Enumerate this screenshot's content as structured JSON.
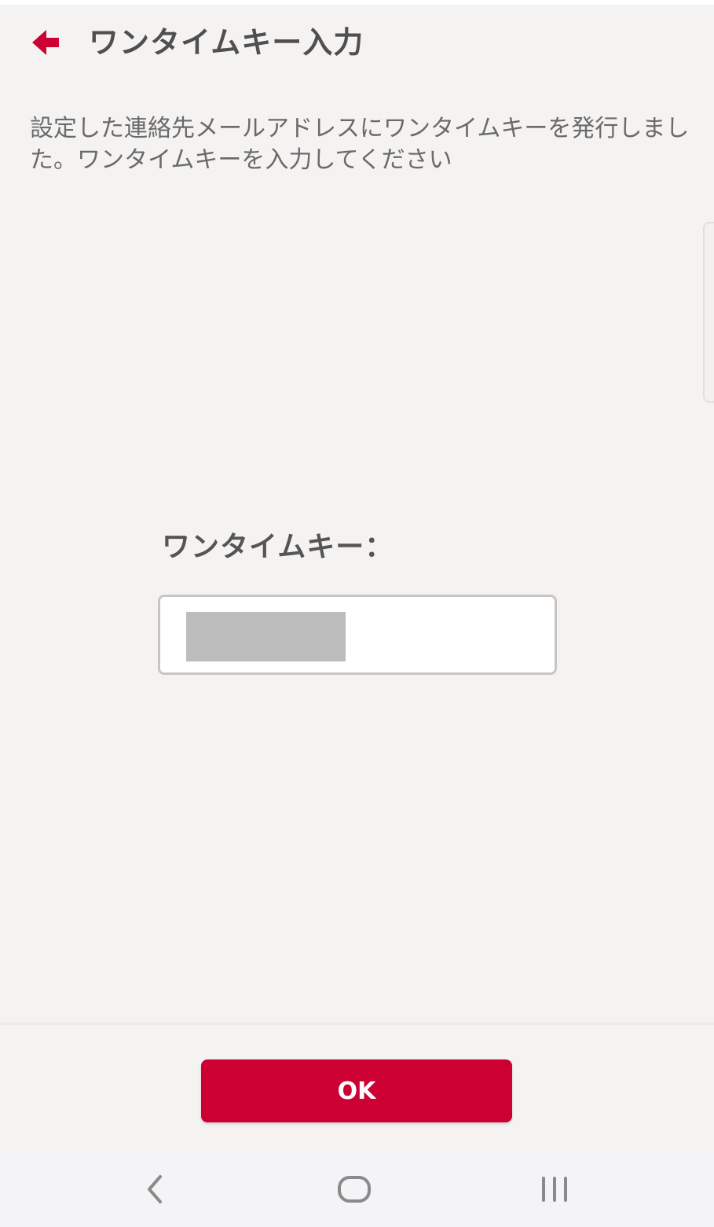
{
  "header": {
    "title": "ワンタイムキー入力",
    "back_icon": "arrow-left-icon",
    "accent_color": "#cc0033"
  },
  "description": "設定した連絡先メールアドレスにワンタイムキーを発行しました。ワンタイムキーを入力してください",
  "form": {
    "label": "ワンタイムキー：",
    "value": ""
  },
  "footer": {
    "ok_label": "OK"
  },
  "nav_bar": {
    "back_icon": "nav-back-icon",
    "home_icon": "nav-home-icon",
    "recents_icon": "nav-recents-icon"
  }
}
